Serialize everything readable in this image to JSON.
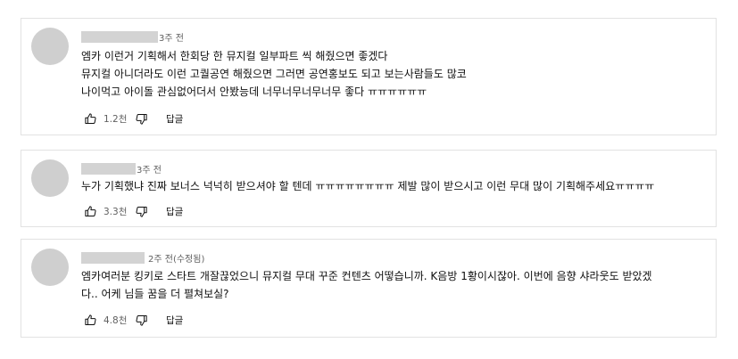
{
  "comments": [
    {
      "time": "3주 전",
      "text": "엠카 이런거 기획해서 한회당 한 뮤지컬 일부파트 씩 해줬으면 좋겠다\n뮤지컬 아니더라도 이런 고퀄공연 해줬으면 그러면 공연홍보도 되고 보는사람들도 많코\n나이먹고 아이돌 관심없어더서 안봤능데 너무너무너무너무 좋다 ㅠㅠㅠㅠㅠㅠ",
      "likes": "1.2천",
      "reply_label": "답글"
    },
    {
      "time": "3주 전",
      "text": "누가 기획했냐 진짜 보너스 넉넉히 받으셔야 할 텐데 ㅠㅠㅠㅠㅠㅠㅠㅠ 제발 많이 받으시고 이런 무대 많이 기획해주세요ㅠㅠㅠㅠ",
      "likes": "3.3천",
      "reply_label": "답글"
    },
    {
      "time": "2주 전(수정됨)",
      "text": "엠카여러분 킹키로 스타트 개잘끊었으니 뮤지컬 무대 꾸준 컨텐츠 어떻습니까. K음방 1황이시잖아. 이번에 음향 샤라웃도 받았겠\n다.. 어케 님들 꿈을 더 펼쳐보실?",
      "likes": "4.8천",
      "reply_label": "답글"
    }
  ],
  "icons": {
    "like": "thumbs-up-icon",
    "dislike": "thumbs-down-icon"
  }
}
